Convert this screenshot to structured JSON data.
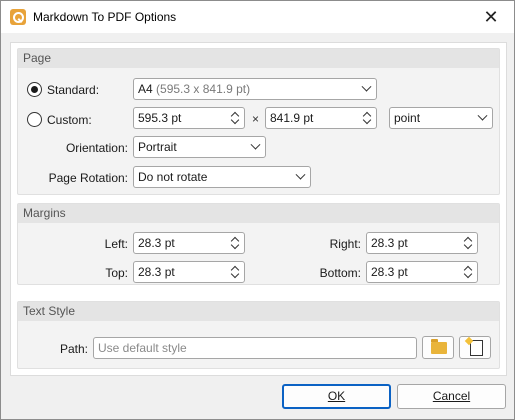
{
  "window": {
    "title": "Markdown To PDF Options",
    "close_icon": "close-icon",
    "app_icon": "app-icon"
  },
  "page_group": {
    "header": "Page",
    "standard_label": "Standard:",
    "standard_selected": true,
    "standard_value_main": "A4",
    "standard_value_dims": "(595.3 x 841.9 pt)",
    "custom_label": "Custom:",
    "custom_width": "595.3 pt",
    "times": "×",
    "custom_height": "841.9 pt",
    "unit": "point",
    "orientation_label": "Orientation:",
    "orientation_value": "Portrait",
    "rotation_label": "Page Rotation:",
    "rotation_value": "Do not rotate"
  },
  "margins_group": {
    "header": "Margins",
    "left_label": "Left:",
    "left_value": "28.3 pt",
    "right_label": "Right:",
    "right_value": "28.3 pt",
    "top_label": "Top:",
    "top_value": "28.3 pt",
    "bottom_label": "Bottom:",
    "bottom_value": "28.3 pt"
  },
  "text_style_group": {
    "header": "Text Style",
    "path_label": "Path:",
    "path_placeholder": "Use default style",
    "browse_icon": "folder-open-icon",
    "new_icon": "new-file-icon"
  },
  "footer": {
    "ok_label": "OK",
    "cancel_label": "Cancel"
  }
}
